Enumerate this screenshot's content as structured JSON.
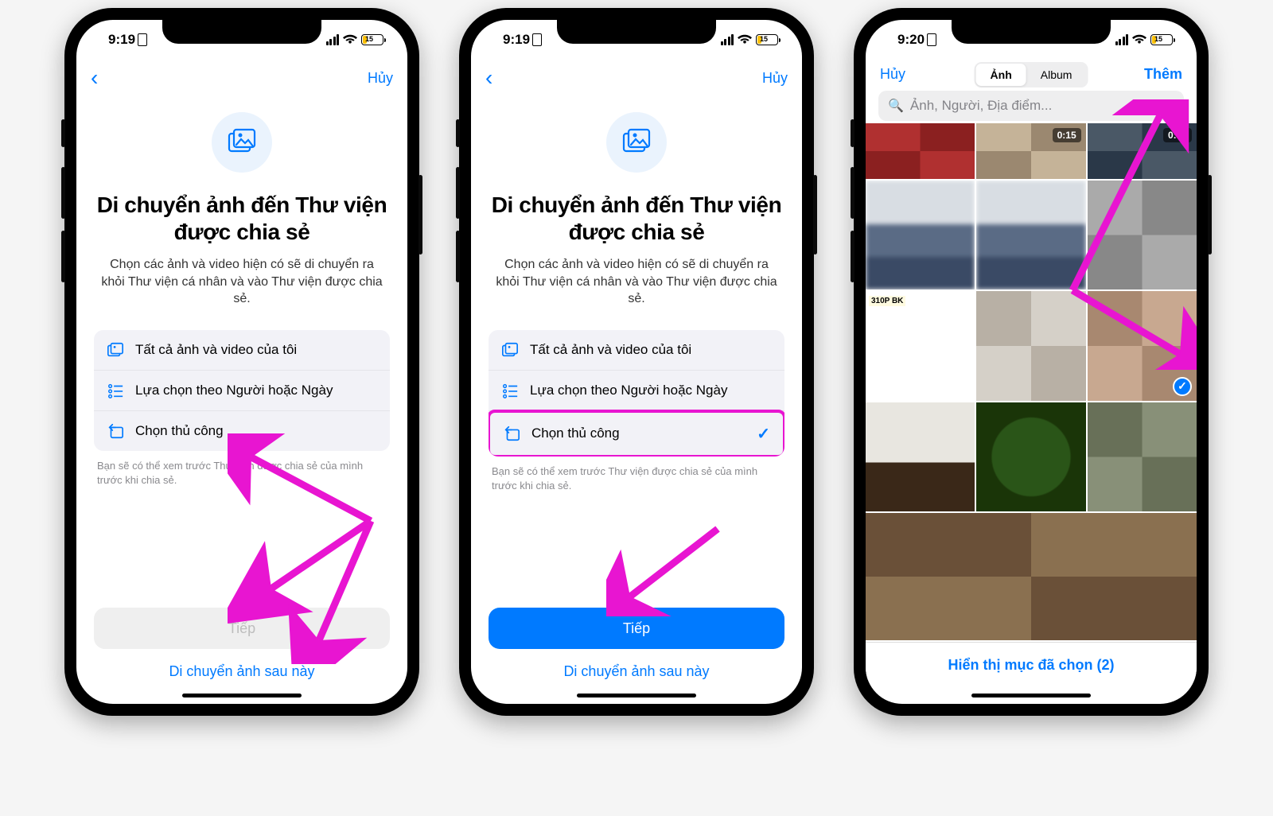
{
  "status": {
    "time1": "9:19",
    "time3": "9:20",
    "battery_pct": "15"
  },
  "nav": {
    "cancel": "Hủy"
  },
  "screen": {
    "title": "Di chuyển ảnh đến Thư viện được chia sẻ",
    "subtitle": "Chọn các ảnh và video hiện có sẽ di chuyển ra khỏi Thư viện cá nhân và vào Thư viện được chia sẻ.",
    "options": {
      "all": "Tất cả ảnh và video của tôi",
      "people": "Lựa chọn theo Người hoặc Ngày",
      "manual": "Chọn thủ công"
    },
    "hint": "Bạn sẽ có thể xem trước Thư viện được chia sẻ của mình trước khi chia sẻ.",
    "next": "Tiếp",
    "later": "Di chuyển ảnh sau này"
  },
  "picker": {
    "cancel": "Hủy",
    "add": "Thêm",
    "seg_photos": "Ảnh",
    "seg_albums": "Album",
    "search_placeholder": "Ảnh, Người, Địa điểm...",
    "footer": "Hiển thị mục đã chọn (2)",
    "dur1": "0:15",
    "dur2": "0:48",
    "doc_text": "310P BK"
  }
}
